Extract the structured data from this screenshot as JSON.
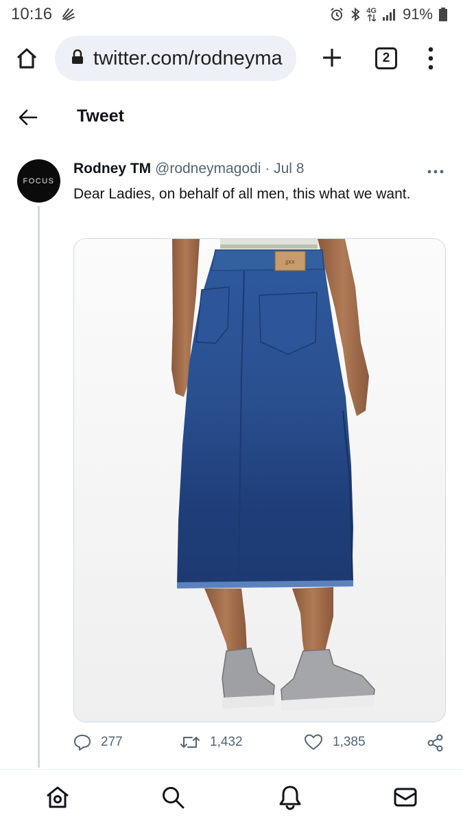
{
  "status_bar": {
    "time": "10:16",
    "battery": "91%",
    "network": "4G"
  },
  "browser": {
    "url": "twitter.com/rodneyma",
    "tab_count": "2"
  },
  "header": {
    "title": "Tweet"
  },
  "tweet": {
    "avatar_text": "FOCUS",
    "author_name": "Rodney TM",
    "handle": "@rodneymagodi",
    "separator": "·",
    "date": "Jul 8",
    "text": "Dear Ladies, on behalf of all men, this what we want.",
    "media_label": "JJXX"
  },
  "actions": {
    "replies": "277",
    "retweets": "1,432",
    "likes": "1,385"
  },
  "colors": {
    "secondary_text": "#536471",
    "divider": "#cfd9de",
    "url_pill": "#eef0f7"
  }
}
